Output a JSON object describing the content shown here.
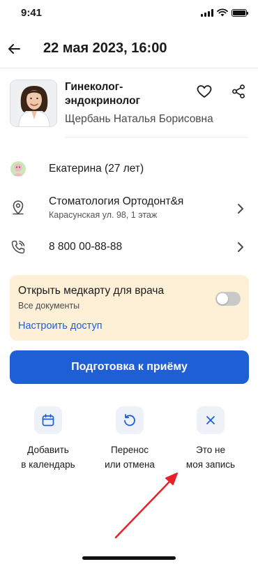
{
  "status_bar": {
    "time": "9:41"
  },
  "header": {
    "title": "22 мая 2023, 16:00"
  },
  "doctor": {
    "specialty_line1": "Гинеколог-",
    "specialty_line2": "эндокринолог",
    "name": "Щербань Наталья Борисовна"
  },
  "rows": {
    "patient": "Екатерина (27 лет)",
    "clinic_name": "Стоматология Ортодонт&я",
    "clinic_address": "Карасунская ул. 98, 1 этаж",
    "phone": "8 800 00-88-88"
  },
  "medcard": {
    "title": "Открыть медкарту для врача",
    "subtitle": "Все документы",
    "link": "Настроить доступ",
    "toggle_on": false
  },
  "primary_button": "Подготовка к приёму",
  "actions": [
    {
      "line1": "Добавить",
      "line2": "в календарь",
      "icon": "calendar-icon"
    },
    {
      "line1": "Перенос",
      "line2": "или отмена",
      "icon": "reschedule-icon"
    },
    {
      "line1": "Это не",
      "line2": "моя запись",
      "icon": "close-icon"
    }
  ],
  "colors": {
    "accent": "#1f5fd6",
    "medcard_bg": "#fdf0d7",
    "annotation_arrow": "#e8202a"
  }
}
